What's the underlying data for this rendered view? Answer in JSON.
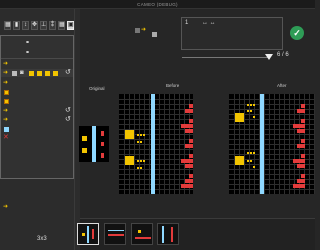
{
  "window": {
    "title": "CAMEO (DEBUG)"
  },
  "toolbar": {
    "buttons": [
      "fill-tool",
      "select-tool",
      "rotate-tool",
      "flip-tool",
      "translate-tool",
      "random-tool",
      "grid-tool",
      "settings-tool"
    ]
  },
  "top_panel": {
    "slot_label": "1",
    "arrows": "↔  ↔"
  },
  "progress": {
    "value": 6,
    "total": 6,
    "label": "6 / 6"
  },
  "panels": {
    "original": "Original",
    "before": "Before",
    "after": "After"
  },
  "bottom": {
    "grid_size": "3x3"
  },
  "colors": {
    "accent": "#f2c400",
    "cyan": "#8fd8ff",
    "red": "#e33b3b",
    "success": "#2e9c56"
  }
}
